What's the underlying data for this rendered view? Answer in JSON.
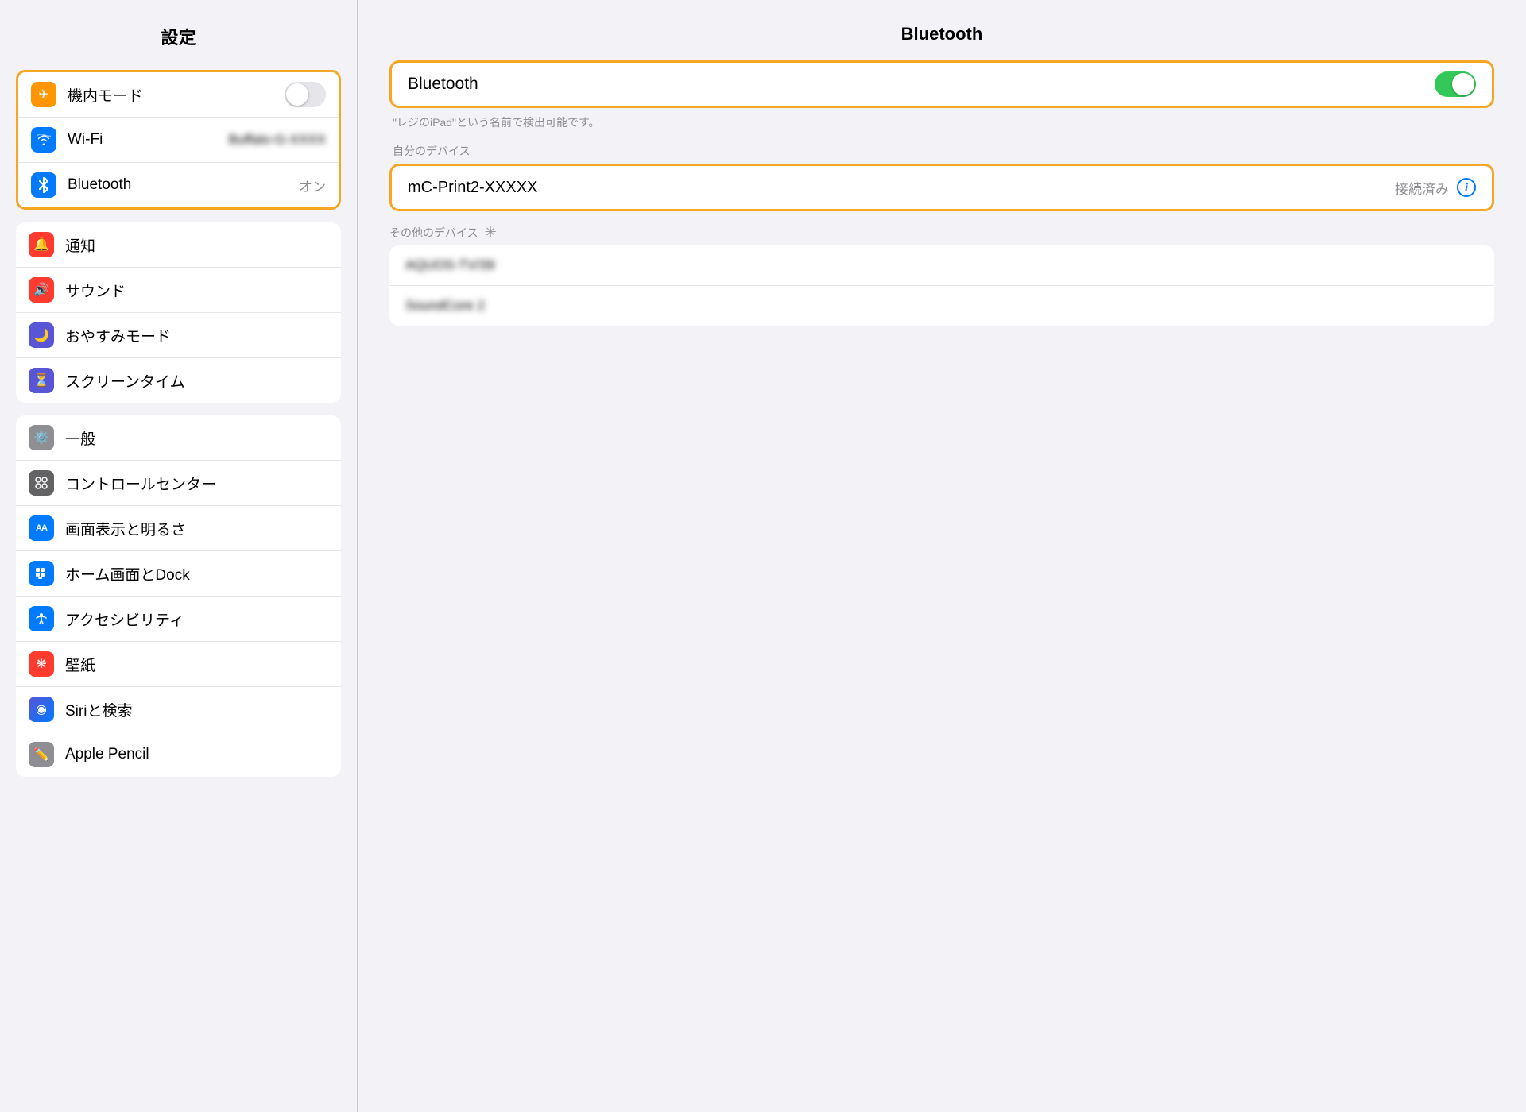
{
  "sidebar": {
    "title": "設定",
    "groups": [
      {
        "id": "group1",
        "highlighted": false,
        "items": [
          {
            "id": "airplane",
            "label": "機内モード",
            "icon": "✈",
            "iconBg": "bg-orange",
            "hasToggle": true,
            "toggleOn": false,
            "value": ""
          },
          {
            "id": "wifi",
            "label": "Wi-Fi",
            "icon": "wifi",
            "iconBg": "bg-blue",
            "hasToggle": false,
            "toggleOn": false,
            "value": "Buffalo-G-XXXX"
          },
          {
            "id": "bluetooth",
            "label": "Bluetooth",
            "icon": "bluetooth",
            "iconBg": "bg-blue",
            "hasToggle": false,
            "toggleOn": false,
            "value": "オン",
            "highlighted": true
          }
        ]
      },
      {
        "id": "group2",
        "highlighted": false,
        "items": [
          {
            "id": "notifications",
            "label": "通知",
            "icon": "🔔",
            "iconBg": "bg-red",
            "hasToggle": false,
            "value": ""
          },
          {
            "id": "sound",
            "label": "サウンド",
            "icon": "🔊",
            "iconBg": "bg-pink-red",
            "hasToggle": false,
            "value": ""
          },
          {
            "id": "donotdisturb",
            "label": "おやすみモード",
            "icon": "🌙",
            "iconBg": "bg-purple",
            "hasToggle": false,
            "value": ""
          },
          {
            "id": "screentime",
            "label": "スクリーンタイム",
            "icon": "⏳",
            "iconBg": "bg-indigo",
            "hasToggle": false,
            "value": ""
          }
        ]
      },
      {
        "id": "group3",
        "highlighted": false,
        "items": [
          {
            "id": "general",
            "label": "一般",
            "icon": "⚙",
            "iconBg": "bg-gray",
            "hasToggle": false,
            "value": ""
          },
          {
            "id": "controlcenter",
            "label": "コントロールセンター",
            "icon": "⊞",
            "iconBg": "bg-dark-gray",
            "hasToggle": false,
            "value": ""
          },
          {
            "id": "display",
            "label": "画面表示と明るさ",
            "icon": "AA",
            "iconBg": "bg-blue-aa",
            "hasToggle": false,
            "value": ""
          },
          {
            "id": "homescreen",
            "label": "ホーム画面とDock",
            "icon": "⠿",
            "iconBg": "bg-home",
            "hasToggle": false,
            "value": ""
          },
          {
            "id": "accessibility",
            "label": "アクセシビリティ",
            "icon": "♿",
            "iconBg": "bg-access",
            "hasToggle": false,
            "value": ""
          },
          {
            "id": "wallpaper",
            "label": "壁紙",
            "icon": "❋",
            "iconBg": "bg-wallpaper",
            "hasToggle": false,
            "value": ""
          },
          {
            "id": "siri",
            "label": "Siriと検索",
            "icon": "◉",
            "iconBg": "bg-siri",
            "hasToggle": false,
            "value": ""
          },
          {
            "id": "pencil",
            "label": "Apple Pencil",
            "icon": "✏",
            "iconBg": "bg-pencil",
            "hasToggle": false,
            "value": ""
          }
        ]
      }
    ]
  },
  "content": {
    "title": "Bluetooth",
    "bluetooth_label": "Bluetooth",
    "bluetooth_on": true,
    "discoverable_hint": "\"レジのiPad\"という名前で検出可能です。",
    "my_devices_label": "自分のデバイス",
    "paired_device": {
      "name": "mC-Print2-XXXXX",
      "status": "接続済み"
    },
    "other_devices_label": "その他のデバイス",
    "other_devices": [
      {
        "name": "AQUOS-TV/39"
      },
      {
        "name": "SoundCore 2"
      }
    ]
  },
  "icons": {
    "airplane": "✈",
    "bluetooth_symbol": "ᛒ",
    "info": "i"
  }
}
